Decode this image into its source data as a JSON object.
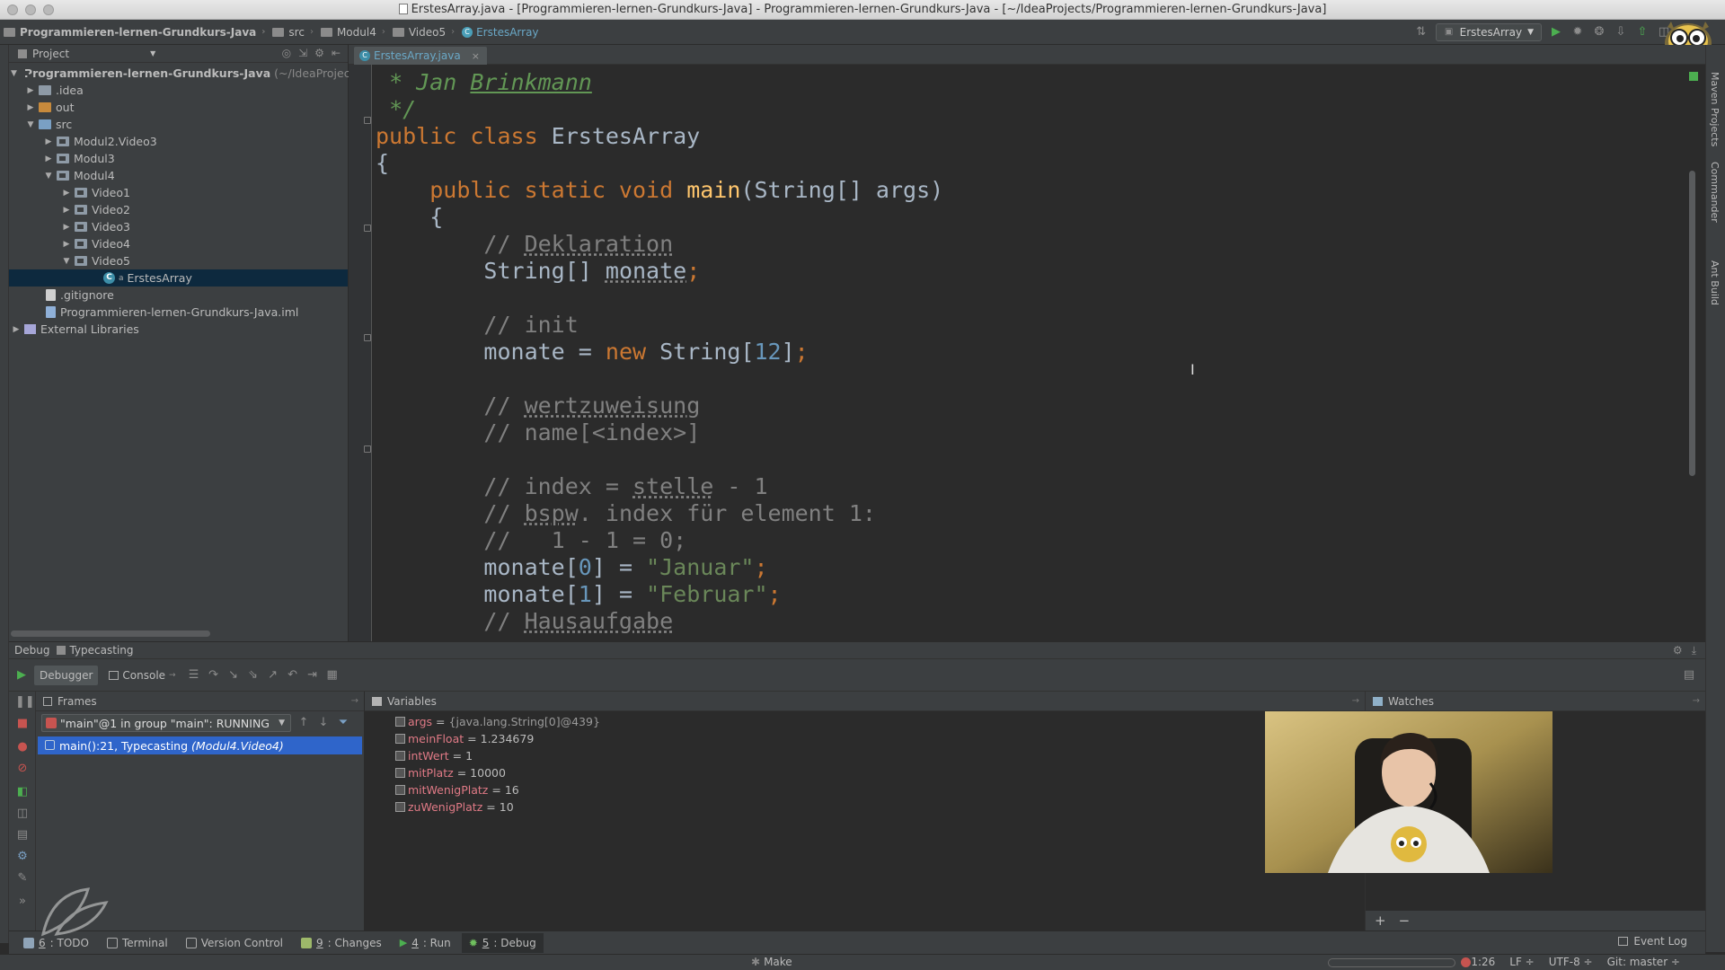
{
  "window": {
    "title": "ErstesArray.java - [Programmieren-lernen-Grundkurs-Java] - Programmieren-lernen-Grundkurs-Java - [~/IdeaProjects/Programmieren-lernen-Grundkurs-Java]"
  },
  "navbar": {
    "crumbs": [
      "Programmieren-lernen-Grundkurs-Java",
      "src",
      "Modul4",
      "Video5",
      "ErstesArray"
    ],
    "run_config": "ErstesArray"
  },
  "project": {
    "header": "Project",
    "root_label": "Programmieren-lernen-Grundkurs-Java",
    "root_path": "(~/IdeaProject",
    "items": [
      ".idea",
      "out",
      "src",
      "Modul2.Video3",
      "Modul3",
      "Modul4",
      "Video1",
      "Video2",
      "Video3",
      "Video4",
      "Video5",
      "ErstesArray",
      ".gitignore",
      "Programmieren-lernen-Grundkurs-Java.iml",
      "External Libraries"
    ]
  },
  "editor": {
    "tab_label": "ErstesArray.java",
    "code": {
      "l1_doc": "* Jan ",
      "l1_name": "Brinkmann",
      "l2_doc": "*/",
      "l3_kw": "public class ",
      "l3_cls": "ErstesArray",
      "l4": "{",
      "l5_indent": "    ",
      "l5_kw": "public static void ",
      "l5_fn": "main",
      "l5_rest": "(String[] args)",
      "l6": "    {",
      "l7_indent": "        ",
      "l7_slash": "// ",
      "l7_word": "Deklaration",
      "l8_indent": "        ",
      "l8_type": "String[] ",
      "l8_var": "monate",
      "l8_semi": ";",
      "l10_indent": "        ",
      "l10": "// init",
      "l11_indent": "        ",
      "l11_a": "monate = ",
      "l11_new": "new ",
      "l11_b": "String[",
      "l11_num": "12",
      "l11_c": "]",
      "l11_semi": ";",
      "l13_indent": "        ",
      "l13_slash": "// ",
      "l13_word": "wertzuweisung",
      "l14_indent": "        ",
      "l14": "// name[<index>]",
      "l16_indent": "        ",
      "l16_a": "// index = ",
      "l16_word": "stelle",
      "l16_b": " - 1",
      "l17_indent": "        ",
      "l17_a": "// ",
      "l17_word": "bspw",
      "l17_b": ". index für element 1:",
      "l18_indent": "        ",
      "l18": "//   1 - 1 = 0;",
      "l19_indent": "        ",
      "l19_a": "monate[",
      "l19_num": "0",
      "l19_b": "] = ",
      "l19_str": "\"Januar\"",
      "l19_semi": ";",
      "l20_indent": "        ",
      "l20_a": "monate[",
      "l20_num": "1",
      "l20_b": "] = ",
      "l20_str": "\"Februar\"",
      "l20_semi": ";",
      "l21_indent": "        ",
      "l21_slash": "// ",
      "l21_word": "Hausaufgabe"
    }
  },
  "debug": {
    "title": "Debug",
    "config": "Typecasting",
    "tabs": [
      "Debugger",
      "Console"
    ],
    "frames_title": "Frames",
    "thread": "\"main\"@1 in group \"main\": RUNNING",
    "frame": "main():21, Typecasting",
    "frame_loc": "(Modul4.Video4)",
    "variables_title": "Variables",
    "variables": [
      {
        "name": "args",
        "value": "{java.lang.String[0]@439}"
      },
      {
        "name": "meinFloat",
        "value": "1.234679"
      },
      {
        "name": "intWert",
        "value": "1"
      },
      {
        "name": "mitPlatz",
        "value": "10000"
      },
      {
        "name": "mitWenigPlatz",
        "value": "16"
      },
      {
        "name": "zuWenigPlatz",
        "value": "10"
      }
    ],
    "watches_title": "Watches"
  },
  "tool_tabs": [
    {
      "num": "6",
      "label": ": TODO"
    },
    {
      "num": "",
      "label": "Terminal"
    },
    {
      "num": "",
      "label": "Version Control"
    },
    {
      "num": "9",
      "label": ": Changes"
    },
    {
      "num": "4",
      "label": ": Run"
    },
    {
      "num": "5",
      "label": ": Debug"
    }
  ],
  "event_log": "Event Log",
  "status": {
    "make": "Make",
    "position": "1:26",
    "line_sep": "LF ÷",
    "encoding": "UTF-8 ÷",
    "vcs": "Git: master ÷"
  },
  "right_strip": [
    "Maven Projects",
    "Commander",
    "Ant Build"
  ],
  "colors": {
    "background": "#2b2b2b",
    "keyword": "#cc7832",
    "function": "#ffc66d",
    "number": "#6897bb",
    "string": "#6a8759",
    "doc_comment": "#629755",
    "selection": "#2f65ca"
  }
}
